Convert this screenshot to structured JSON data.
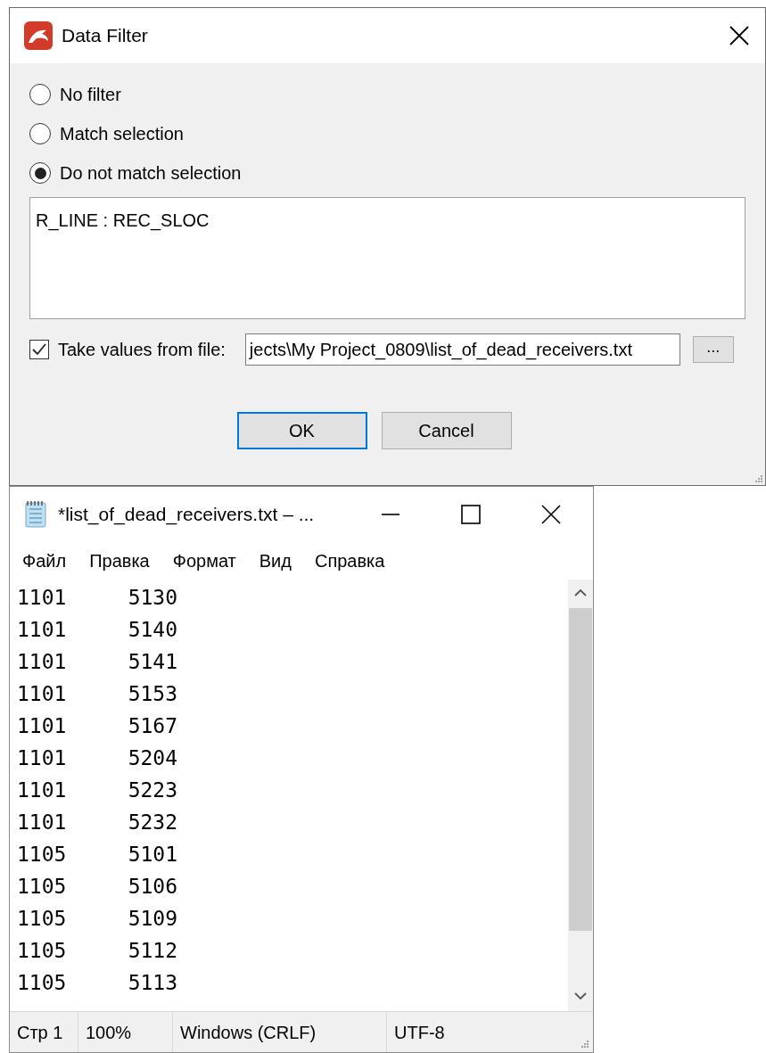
{
  "dialog": {
    "title": "Data Filter",
    "options": [
      {
        "label": "No filter",
        "selected": false
      },
      {
        "label": "Match selection",
        "selected": false
      },
      {
        "label": "Do not match selection",
        "selected": true
      }
    ],
    "selection_text": "R_LINE : REC_SLOC",
    "take_from_file": {
      "label": "Take values from file:",
      "checked": true,
      "value": "jects\\My Project_0809\\list_of_dead_receivers.txt",
      "browse": "..."
    },
    "buttons": [
      {
        "label": "OK",
        "default": true
      },
      {
        "label": "Cancel",
        "default": false
      }
    ]
  },
  "notepad": {
    "title": "*list_of_dead_receivers.txt – ...",
    "menu": [
      "Файл",
      "Правка",
      "Формат",
      "Вид",
      "Справка"
    ],
    "lines": [
      "1101\t5130",
      "1101\t5140",
      "1101\t5141",
      "1101\t5153",
      "1101\t5167",
      "1101\t5204",
      "1101\t5223",
      "1101\t5232",
      "1105\t5101",
      "1105\t5106",
      "1105\t5109",
      "1105\t5112",
      "1105\t5113"
    ],
    "status": [
      "Стр 1",
      "100%",
      "Windows (CRLF)",
      "UTF-8"
    ]
  }
}
